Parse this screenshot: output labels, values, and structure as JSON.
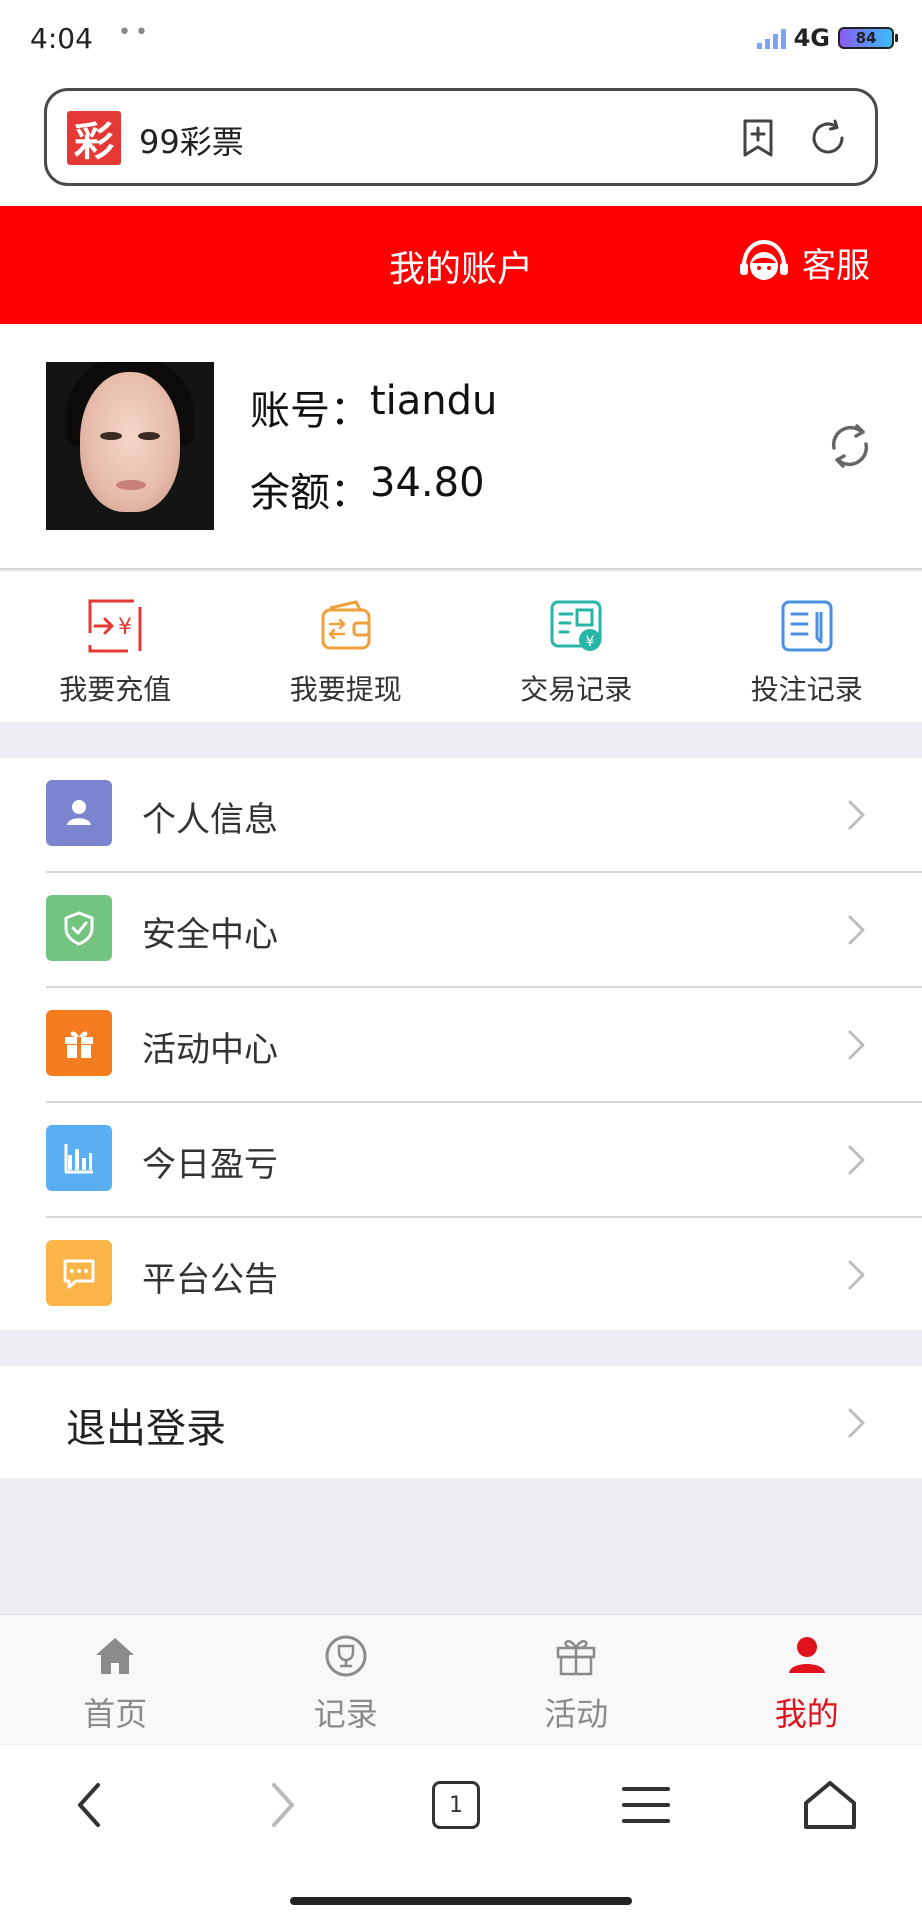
{
  "status_bar": {
    "time": "4:04",
    "dots": "••",
    "network": "4G",
    "battery": "84"
  },
  "address_bar": {
    "logo_char": "彩",
    "site_title": "99彩票"
  },
  "header": {
    "title": "我的账户",
    "service_label": "客服",
    "bg_color": "#ff0000"
  },
  "account": {
    "username_label": "账号：",
    "username": "tiandu",
    "balance_label": "余额：",
    "balance": "34.80"
  },
  "quick_actions": [
    {
      "label": "我要充值",
      "icon": "recharge-icon",
      "color": "#e53935"
    },
    {
      "label": "我要提现",
      "icon": "wallet-icon",
      "color": "#f0a03a"
    },
    {
      "label": "交易记录",
      "icon": "transaction-record-icon",
      "color": "#26b5a7"
    },
    {
      "label": "投注记录",
      "icon": "bet-record-icon",
      "color": "#4a90e2"
    }
  ],
  "menu": [
    {
      "label": "个人信息",
      "icon": "user-icon",
      "color": "#7c83cf"
    },
    {
      "label": "安全中心",
      "icon": "shield-icon",
      "color": "#72c480"
    },
    {
      "label": "活动中心",
      "icon": "gift-icon",
      "color": "#f57c1f"
    },
    {
      "label": "今日盈亏",
      "icon": "bar-chart-icon",
      "color": "#5aaef2"
    },
    {
      "label": "平台公告",
      "icon": "message-icon",
      "color": "#fbb447"
    }
  ],
  "logout": {
    "label": "退出登录"
  },
  "tabs": [
    {
      "label": "首页",
      "icon": "home-icon",
      "active": false
    },
    {
      "label": "记录",
      "icon": "trophy-icon",
      "active": false
    },
    {
      "label": "活动",
      "icon": "gift-icon",
      "active": false
    },
    {
      "label": "我的",
      "icon": "person-icon",
      "active": true
    }
  ],
  "browser_nav": {
    "tab_count": "1"
  }
}
